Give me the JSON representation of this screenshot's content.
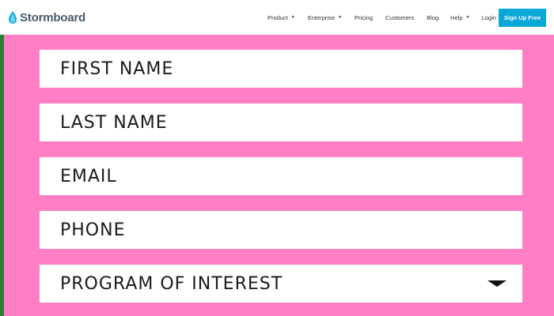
{
  "header": {
    "brand": "Stormboard",
    "nav": [
      {
        "label": "Product",
        "has_caret": true
      },
      {
        "label": "Enterprise",
        "has_caret": true
      },
      {
        "label": "Pricing",
        "has_caret": false
      },
      {
        "label": "Customers",
        "has_caret": false
      },
      {
        "label": "Blog",
        "has_caret": false
      },
      {
        "label": "Help",
        "has_caret": true
      },
      {
        "label": "Login →",
        "has_caret": false
      }
    ],
    "signup_label": "Sign Up Free"
  },
  "form": {
    "fields": [
      {
        "label": "FIRST NAME"
      },
      {
        "label": "LAST NAME"
      },
      {
        "label": "EMAIL"
      },
      {
        "label": "PHONE"
      },
      {
        "label": "PROGRAM OF INTEREST"
      }
    ]
  },
  "colors": {
    "background": "#ff7ec4",
    "signup_button": "#0aa8d8",
    "brand_text": "#4a5a6a",
    "brand_icon": "#1ab0e0"
  }
}
